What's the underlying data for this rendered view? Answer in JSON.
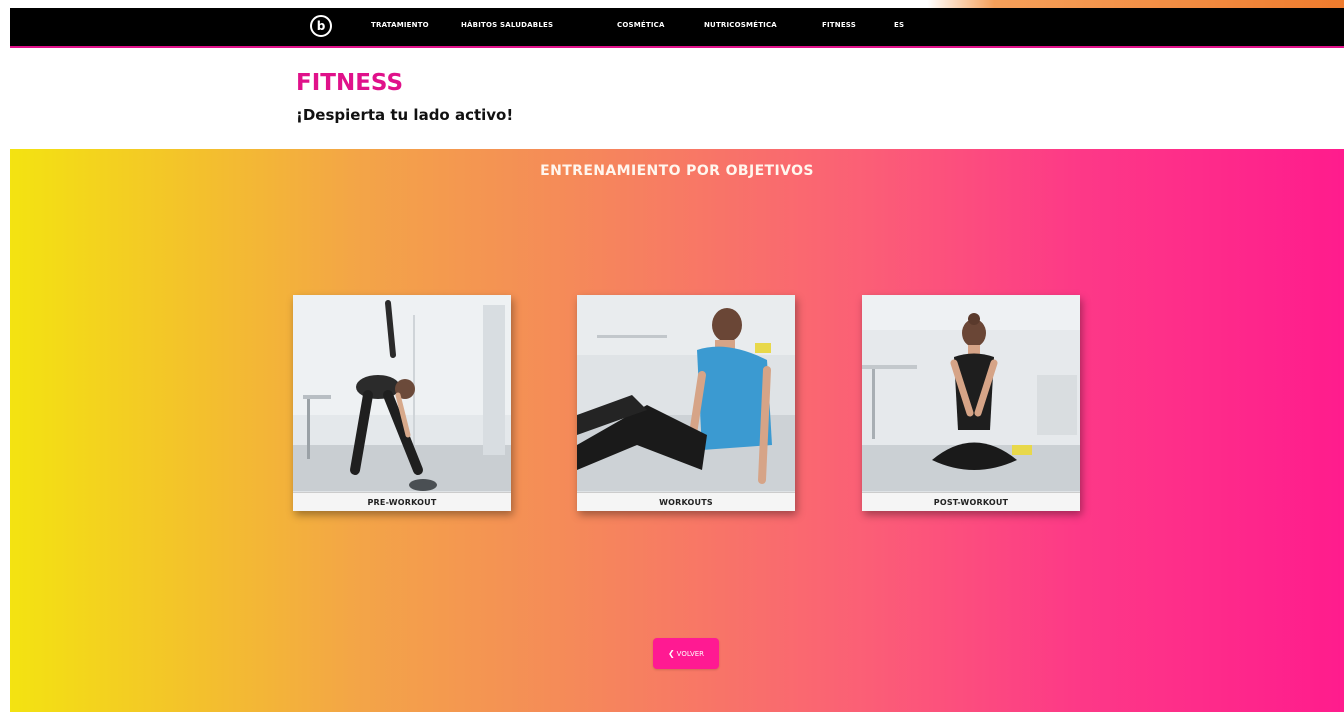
{
  "nav": {
    "logo_icon": "b-circle-logo",
    "items": [
      {
        "label": "TRATAMIENTO"
      },
      {
        "label": "HÁBITOS SALUDABLES"
      },
      {
        "label": "COSMÉTICA"
      },
      {
        "label": "NUTRICOSMÉTICA"
      },
      {
        "label": "FITNESS"
      },
      {
        "label": "ES"
      }
    ]
  },
  "header": {
    "title": "FITNESS",
    "subtitle": "¡Despierta tu lado activo!"
  },
  "hero": {
    "section_title": "ENTRENAMIENTO POR OBJETIVOS",
    "cards": [
      {
        "label": "PRE-WORKOUT"
      },
      {
        "label": "WORKOUTS"
      },
      {
        "label": "POST-WORKOUT"
      }
    ],
    "back_button": {
      "icon": "chevron-left-icon",
      "label": "VOLVER"
    }
  },
  "colors": {
    "brand_pink": "#e0118a",
    "gradient_start": "#f3e311",
    "gradient_end": "#ff1c8d",
    "nav_background": "#000000"
  }
}
